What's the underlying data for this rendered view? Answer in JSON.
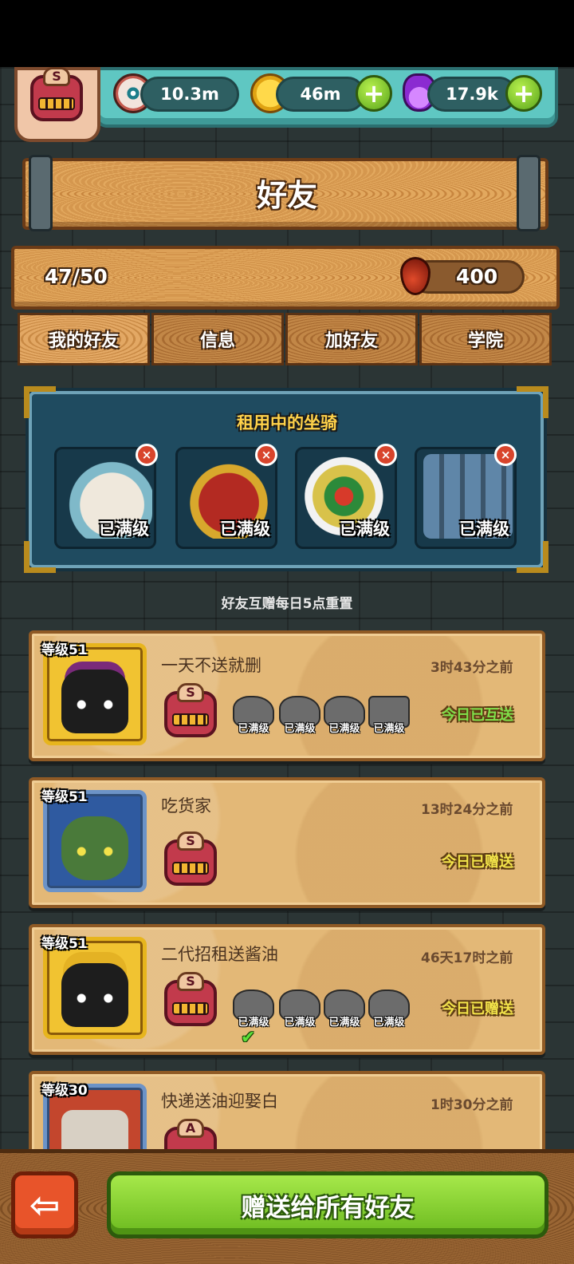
{
  "resources": {
    "eyes": "10.3m",
    "coins": "46m",
    "potion": "17.9k",
    "plus_label": "+"
  },
  "player": {
    "rank_letter": "S"
  },
  "header": {
    "title": "好友"
  },
  "stats": {
    "friend_count": "47/50",
    "blood": "400"
  },
  "tabs": [
    {
      "label": "我的好友",
      "active": true
    },
    {
      "label": "信息",
      "active": false
    },
    {
      "label": "加好友",
      "active": false
    },
    {
      "label": "学院",
      "active": false
    }
  ],
  "rental": {
    "title": "租用中的坐骑",
    "close_label": "×",
    "mounts": [
      {
        "label": "已满级",
        "icon": "white-beast-mount-icon",
        "color": "#e9e2d6"
      },
      {
        "label": "已满级",
        "icon": "red-demon-mount-icon",
        "color": "#b32a22"
      },
      {
        "label": "已满级",
        "icon": "lion-dance-mount-icon",
        "color": "#d8c24a"
      },
      {
        "label": "已满级",
        "icon": "cannon-machine-mount-icon",
        "color": "#5f86a8"
      }
    ]
  },
  "reset_note": "好友互赠每日5点重置",
  "friends": [
    {
      "level": "等级51",
      "name": "一天不送就删",
      "time": "3时43分之前",
      "rank": "S",
      "status": "今日已互送",
      "status_color": "#7fe04a",
      "mounts": [
        "已满级",
        "已满级",
        "已满级",
        "已满级"
      ],
      "checked": false
    },
    {
      "level": "等级51",
      "name": "吃货家",
      "time": "13时24分之前",
      "rank": "S",
      "status": "今日已赠送",
      "status_color": "#f3e44a",
      "mounts": [],
      "checked": false
    },
    {
      "level": "等级51",
      "name": "二代招租送酱油",
      "time": "46天17时之前",
      "rank": "S",
      "status": "今日已赠送",
      "status_color": "#f3e44a",
      "mounts": [
        "已满级",
        "已满级",
        "已满级",
        "已满级"
      ],
      "checked": true,
      "check_mark": "✔"
    },
    {
      "level": "等级30",
      "name": "快递送油迎娶白",
      "time": "1时30分之前",
      "rank": "A",
      "status": "",
      "mounts": [],
      "checked": false
    }
  ],
  "bottom": {
    "back_label": "⇦",
    "send_all_label": "赠送给所有好友"
  }
}
